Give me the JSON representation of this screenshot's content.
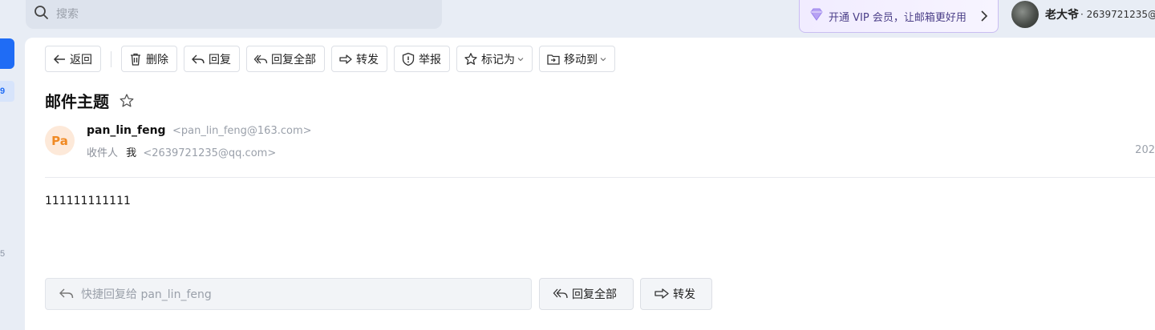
{
  "search": {
    "placeholder": "搜索"
  },
  "vip": {
    "text": "开通 VIP 会员，让邮箱更好用"
  },
  "user": {
    "name": "老大爷",
    "email": "· 2639721235@"
  },
  "left": {
    "badge": "9",
    "num": "5"
  },
  "toolbar": {
    "back": "返回",
    "delete": "删除",
    "reply": "回复",
    "reply_all": "回复全部",
    "forward": "转发",
    "report": "举报",
    "mark_as": "标记为",
    "move_to": "移动到"
  },
  "mail": {
    "subject": "邮件主题",
    "sender_initials": "Pa",
    "sender_name": "pan_lin_feng",
    "sender_address": "<pan_lin_feng@163.com>",
    "recipient_label": "收件人",
    "recipient_name": "我",
    "recipient_address": "<2639721235@qq.com>",
    "date": "202",
    "body": "111111111111"
  },
  "footer": {
    "quick_reply_placeholder": "快捷回复给 pan_lin_feng",
    "reply_all": "回复全部",
    "forward": "转发"
  },
  "colors": {
    "accent": "#1f6cf5",
    "avatar_bg": "#fde9d9",
    "avatar_fg": "#f08a24"
  }
}
